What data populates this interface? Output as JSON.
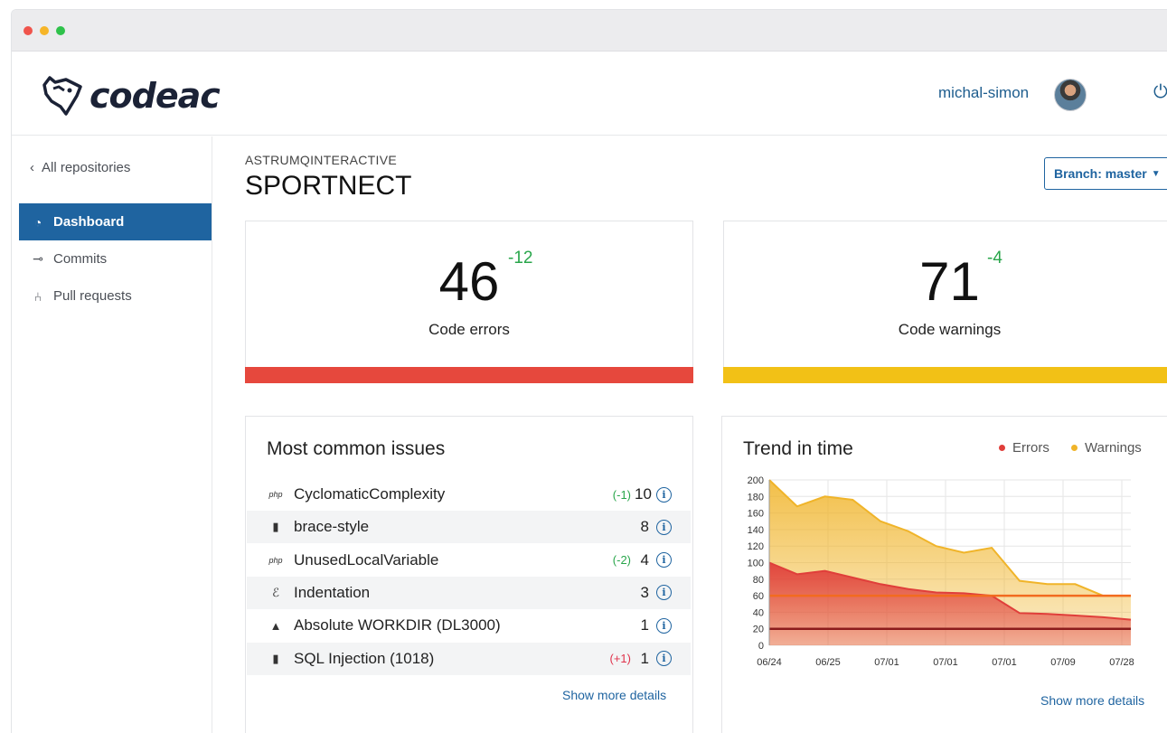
{
  "brand": {
    "name": "codeac"
  },
  "user": {
    "name": "michal-simon"
  },
  "sidebar": {
    "back_label": "All repositories",
    "items": [
      {
        "label": "Dashboard",
        "active": true,
        "icon": "gauge-icon"
      },
      {
        "label": "Commits",
        "active": false,
        "icon": "commit-icon"
      },
      {
        "label": "Pull requests",
        "active": false,
        "icon": "pull-request-icon"
      }
    ]
  },
  "repo": {
    "org": "ASTRUMQINTERACTIVE",
    "name": "SPORTNECT",
    "branch_label": "Branch: master"
  },
  "stats": {
    "errors": {
      "value": "46",
      "delta": "-12",
      "label": "Code errors",
      "color": "#e6483d"
    },
    "warnings": {
      "value": "71",
      "delta": "-4",
      "label": "Code warnings",
      "color": "#f2c116"
    }
  },
  "issues": {
    "title": "Most common issues",
    "rows": [
      {
        "icon": "php-icon",
        "name": "CyclomaticComplexity",
        "delta": "(-1)",
        "delta_type": "neg",
        "count": "10"
      },
      {
        "icon": "js-icon",
        "name": "brace-style",
        "delta": "",
        "delta_type": "",
        "count": "8"
      },
      {
        "icon": "php-icon",
        "name": "UnusedLocalVariable",
        "delta": "(-2)",
        "delta_type": "neg",
        "count": "4"
      },
      {
        "icon": "sass-icon",
        "name": "Indentation",
        "delta": "",
        "delta_type": "",
        "count": "3"
      },
      {
        "icon": "docker-icon",
        "name": "Absolute WORKDIR (DL3000)",
        "delta": "",
        "delta_type": "",
        "count": "1"
      },
      {
        "icon": "js-icon",
        "name": "SQL Injection (1018)",
        "delta": "(+1)",
        "delta_type": "pos",
        "count": "1"
      }
    ],
    "show_more": "Show more details"
  },
  "trend": {
    "title": "Trend in time",
    "show_more": "Show more details",
    "colors": {
      "errors": "#e03e3a",
      "warnings": "#f0b429"
    }
  },
  "chart_data": {
    "type": "area",
    "title": "Trend in time",
    "x": [
      "06/24",
      "",
      "06/25",
      "",
      "07/01",
      "",
      "07/01",
      "",
      "07/01",
      "",
      "07/09",
      "",
      "07/28",
      ""
    ],
    "x_ticks": [
      "06/24",
      "06/25",
      "07/01",
      "07/01",
      "07/01",
      "07/09",
      "07/28"
    ],
    "ylim": [
      0,
      200
    ],
    "y_ticks": [
      0,
      20,
      40,
      60,
      80,
      100,
      120,
      140,
      160,
      180,
      200
    ],
    "grid": true,
    "legend": "top-right",
    "series": [
      {
        "name": "Warnings",
        "values": [
          200,
          168,
          180,
          176,
          150,
          138,
          120,
          112,
          118,
          78,
          74,
          74,
          60,
          60
        ]
      },
      {
        "name": "Errors",
        "values": [
          100,
          86,
          90,
          82,
          74,
          68,
          64,
          63,
          60,
          39,
          38,
          36,
          34,
          31
        ]
      }
    ],
    "threshold_lines": [
      {
        "series": "Warnings",
        "value": 60
      },
      {
        "series": "Errors",
        "value": 20
      }
    ]
  }
}
